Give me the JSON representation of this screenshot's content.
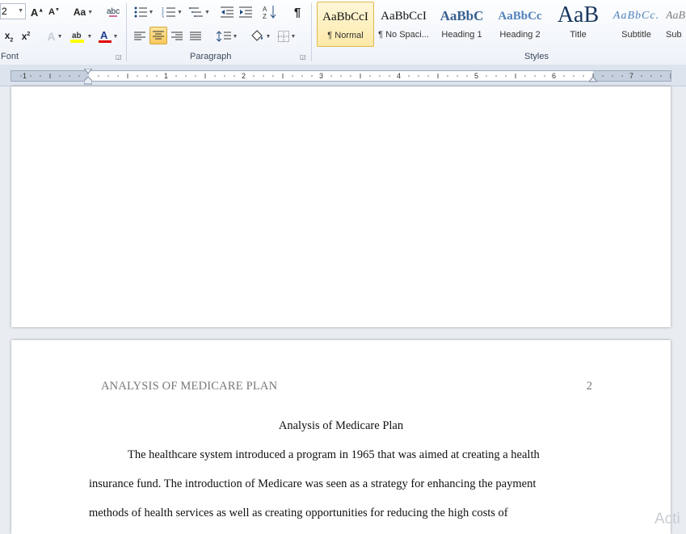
{
  "ribbon": {
    "font": {
      "size_value": "2",
      "group_label": "Font"
    },
    "paragraph": {
      "group_label": "Paragraph"
    },
    "styles": {
      "group_label": "Styles",
      "tiles": [
        {
          "sample": "AaBbCcI",
          "name": "¶ Normal"
        },
        {
          "sample": "AaBbCcI",
          "name": "¶ No Spaci..."
        },
        {
          "sample": "AaBbC",
          "name": "Heading 1"
        },
        {
          "sample": "AaBbCc",
          "name": "Heading 2"
        },
        {
          "sample": "AaB",
          "name": "Title"
        },
        {
          "sample": "AaBbCc.",
          "name": "Subtitle"
        },
        {
          "sample": "AaB",
          "name": "Sub"
        }
      ]
    },
    "colors": {
      "highlight": "#ffff00",
      "font_color": "#e00000",
      "heading_blue": "#1f497d"
    }
  },
  "ruler": {
    "numbers": [
      "1",
      "1",
      "2",
      "3",
      "4",
      "5",
      "6",
      "7"
    ]
  },
  "document": {
    "running_head": "ANALYSIS OF MEDICARE PLAN",
    "page_number": "2",
    "title": "Analysis of Medicare Plan",
    "lines": [
      "The healthcare system introduced a program in 1965 that was aimed at creating a health",
      "insurance fund. The introduction of Medicare was seen as a strategy for enhancing the payment",
      "methods of health services as well as creating opportunities for reducing the high costs of"
    ]
  },
  "watermark": "Acti"
}
